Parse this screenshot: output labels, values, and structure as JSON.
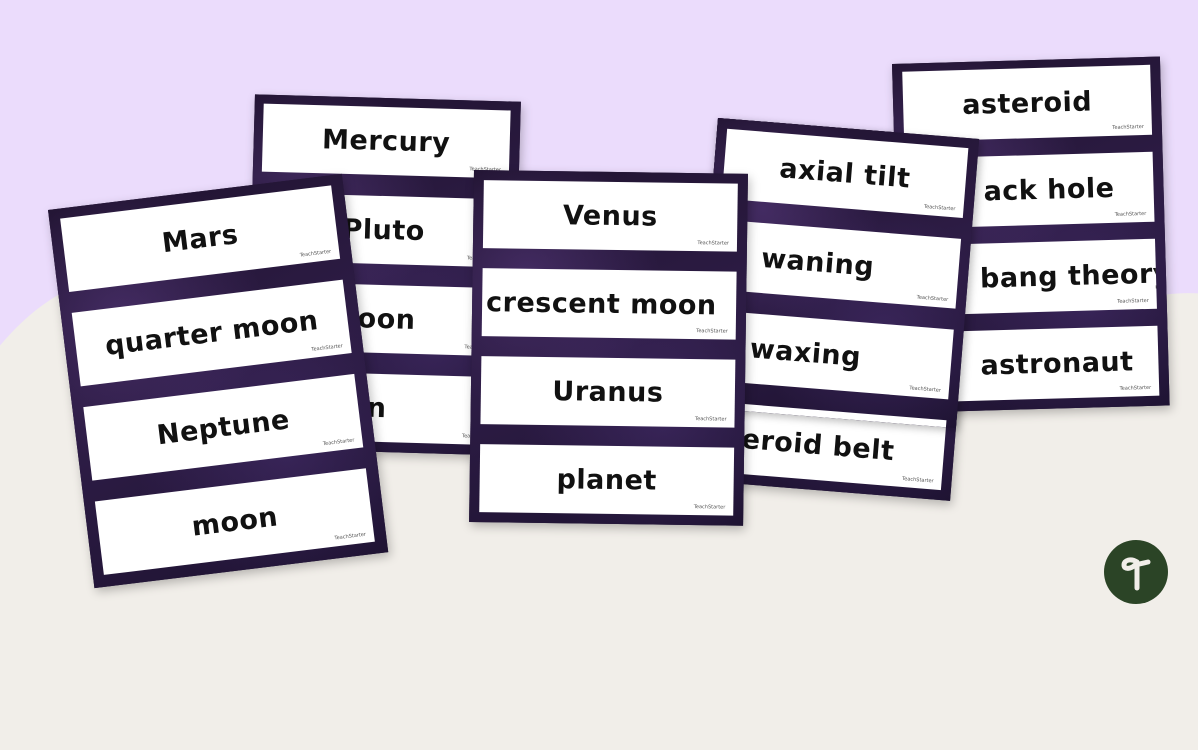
{
  "colors": {
    "background_top": "#ebdcfc",
    "background_bottom": "#f1eee9",
    "strip": "#241636",
    "card": "#ffffff",
    "text": "#111111",
    "logo": "#2b4426"
  },
  "watermark": "TeachStarter",
  "strips": [
    {
      "cards": [
        "Mars",
        "quarter moon",
        "Neptune",
        "moon"
      ]
    },
    {
      "cards": [
        "Mercury",
        "Pluto",
        "alf-moon",
        "Saturn"
      ]
    },
    {
      "cards": [
        "Venus",
        "crescent moon",
        "Uranus",
        "planet"
      ]
    },
    {
      "cards": [
        "axial tilt",
        "waning",
        "waxing",
        "steroid belt"
      ]
    },
    {
      "cards": [
        "asteroid",
        "ack hole",
        "bang theory",
        "astronaut"
      ]
    }
  ],
  "logo": {
    "icon": "teach-starter-t-icon"
  }
}
